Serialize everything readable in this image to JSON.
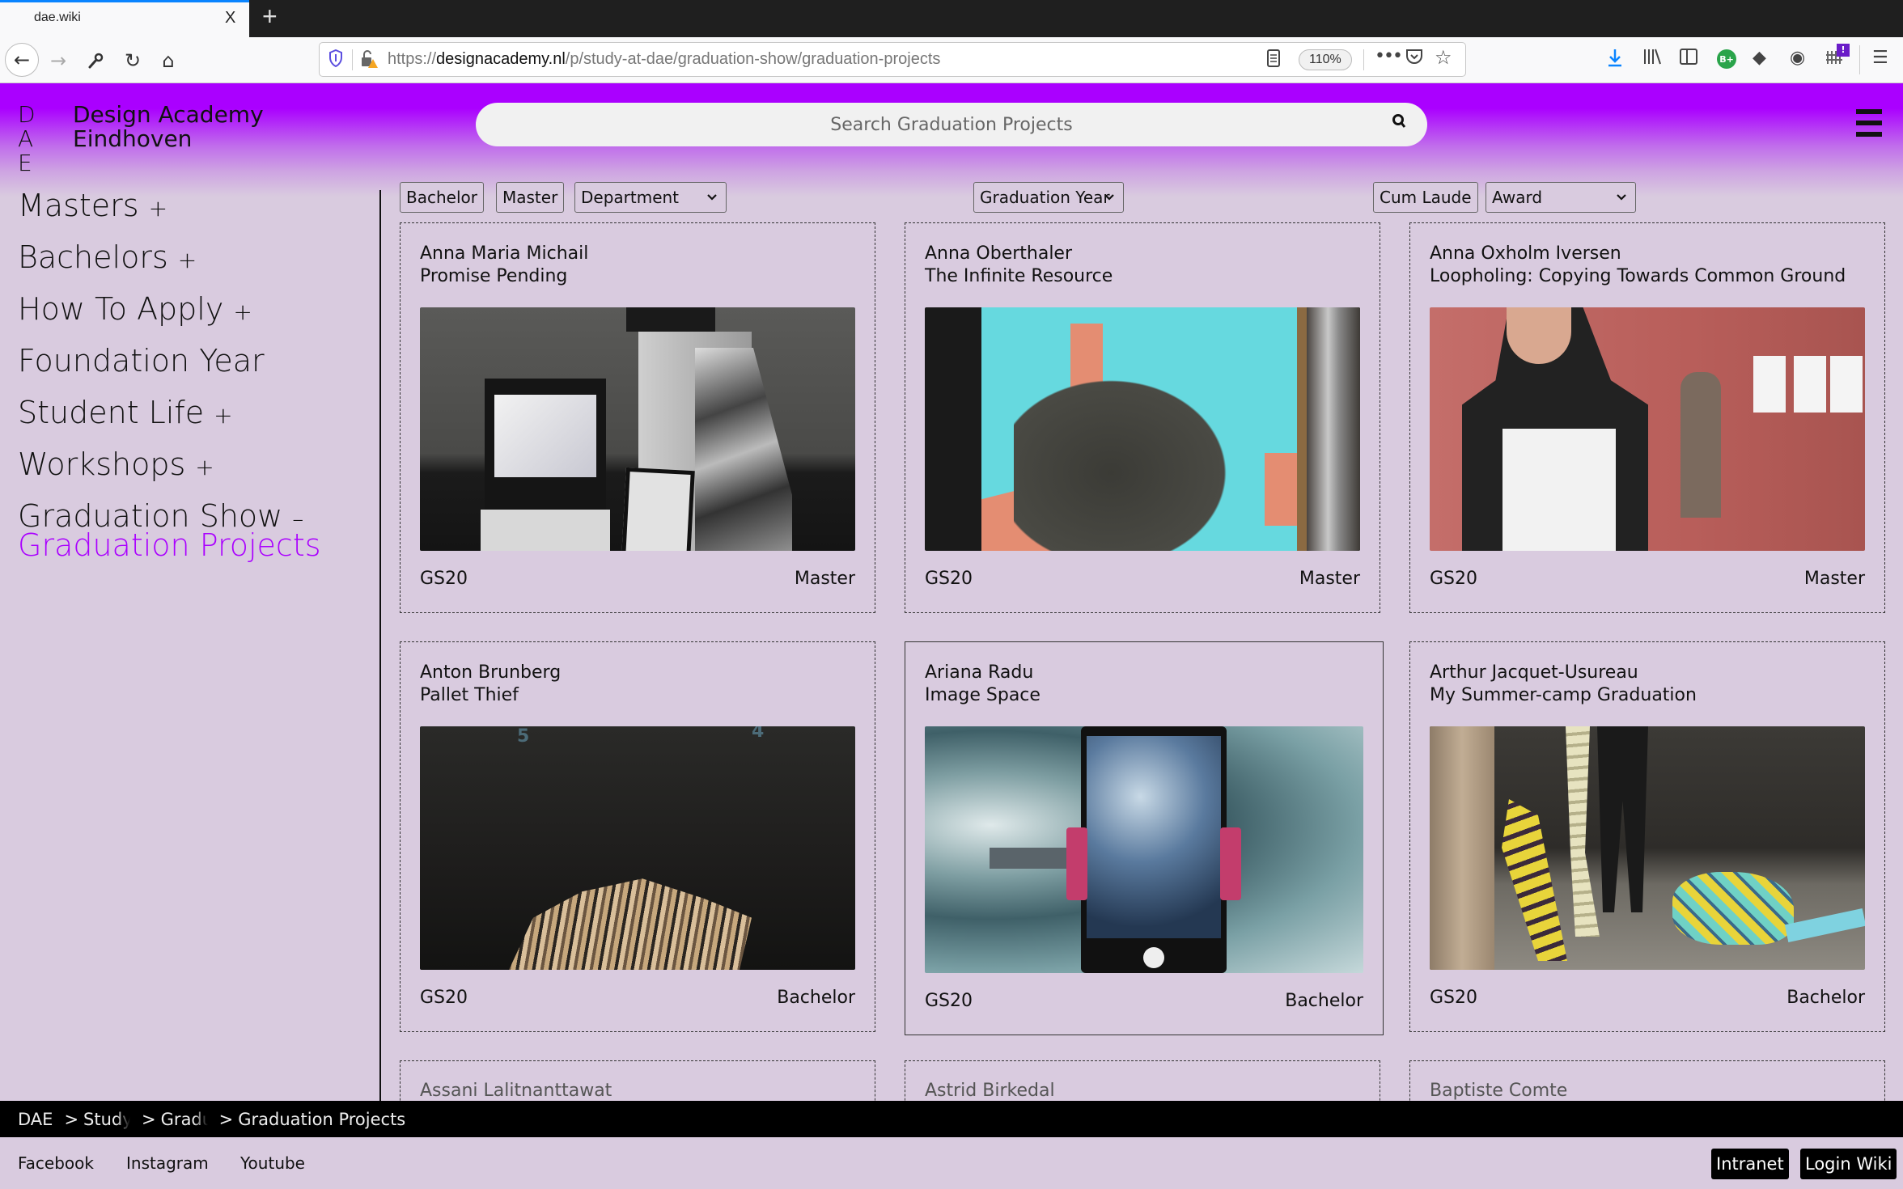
{
  "browser": {
    "tab_title": "dae.wiki",
    "tab_close": "X",
    "new_tab": "+",
    "url_prefix": "https://",
    "url_domain": "designacademy.nl",
    "url_path": "/p/study-at-dae/graduation-show/graduation-projects",
    "zoom_level": "110%",
    "icons": {
      "back": "←",
      "forward": "→",
      "tools": "⚒",
      "reload": "↻",
      "home": "⌂",
      "shield": "⛉",
      "lock": "🔓",
      "reader": "▤",
      "more": "•••",
      "pocket": "⛉",
      "star": "☆",
      "download": "⤓",
      "library": "⫼",
      "sidebar": "◫",
      "bplus": "B+",
      "ext": "◆",
      "account": "◉",
      "ext2": "⫶",
      "ext2_badge": "!",
      "menu": "☰"
    }
  },
  "header": {
    "logo_mark_line1": "D A",
    "logo_mark_line2": "E",
    "logo_name_line1": "Design Academy",
    "logo_name_line2": "Eindhoven",
    "search_placeholder": "Search Graduation Projects",
    "search_icon": "⚲"
  },
  "sidebar": {
    "items": [
      {
        "label": "Masters",
        "sign": "+"
      },
      {
        "label": "Bachelors",
        "sign": "+"
      },
      {
        "label": "How To Apply",
        "sign": "+"
      },
      {
        "label": "Foundation Year",
        "sign": ""
      },
      {
        "label": "Student Life",
        "sign": "+"
      },
      {
        "label": "Workshops",
        "sign": "+"
      },
      {
        "label": "Graduation Show",
        "sign": "–"
      }
    ],
    "active_sub": "Graduation Projects"
  },
  "filters": {
    "bachelor": "Bachelor",
    "master": "Master",
    "department": "Department",
    "graduation_year": "Graduation Year",
    "cum_laude": "Cum Laude",
    "award": "Award",
    "chevron": "⌄"
  },
  "colors": {
    "accent": "#aa00ff",
    "background": "#d9cbdf"
  },
  "projects": [
    {
      "name": "Anna Maria Michail",
      "title": "Promise Pending",
      "year": "GS20",
      "type": "Master"
    },
    {
      "name": "Anna Oberthaler",
      "title": "The Infinite Resource",
      "year": "GS20",
      "type": "Master"
    },
    {
      "name": "Anna Oxholm Iversen",
      "title": "Loopholing: Copying Towards Common Ground",
      "year": "GS20",
      "type": "Master"
    },
    {
      "name": "Anton Brunberg",
      "title": "Pallet Thief",
      "year": "GS20",
      "type": "Bachelor"
    },
    {
      "name": "Ariana Radu",
      "title": "Image Space",
      "year": "GS20",
      "type": "Bachelor"
    },
    {
      "name": "Arthur Jacquet-Usureau",
      "title": "My Summer-camp Graduation",
      "year": "GS20",
      "type": "Bachelor"
    },
    {
      "name": "Assani Lalitnanttawat"
    },
    {
      "name": "Astrid Birkedal"
    },
    {
      "name": "Baptiste Comte"
    }
  ],
  "breadcrumb": [
    {
      "label": "DAE"
    },
    {
      "label": "Study"
    },
    {
      "label": "Graduation Show"
    },
    {
      "label": "Graduation Projects"
    }
  ],
  "breadcrumb_sep": ">",
  "footer": {
    "links": [
      "Facebook",
      "Instagram",
      "Youtube"
    ],
    "buttons": [
      "Intranet",
      "Login Wiki"
    ]
  }
}
